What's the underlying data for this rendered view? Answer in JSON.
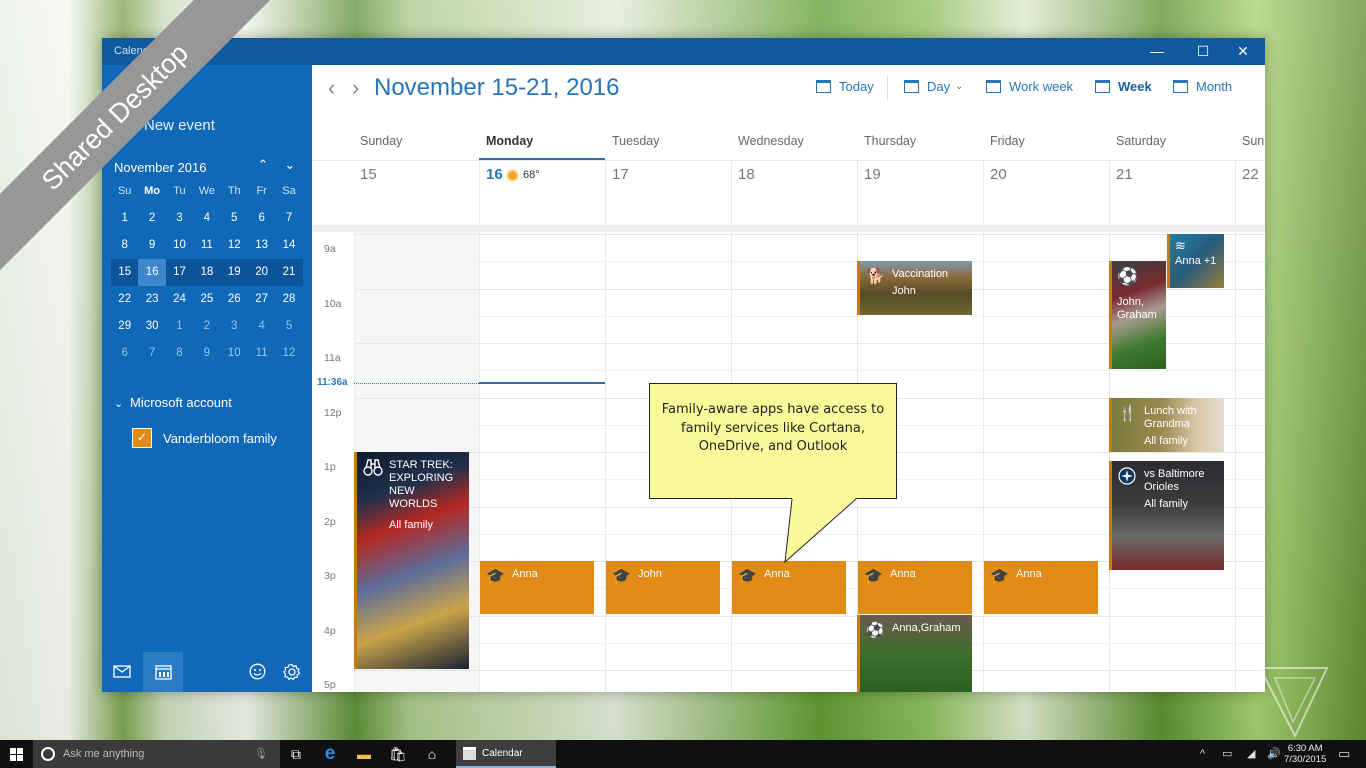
{
  "window": {
    "title": "Calendar",
    "controls": {
      "minimize": "—",
      "maximize": "☐",
      "close": "✕"
    }
  },
  "sidebar": {
    "new_event_label": "New event",
    "mini_calendar": {
      "month_label": "November 2016",
      "prev_icon": "chevron-up-icon",
      "next_icon": "chevron-down-icon",
      "weekdays": [
        "Su",
        "Mo",
        "Tu",
        "We",
        "Th",
        "Fr",
        "Sa"
      ],
      "weeks": [
        [
          "1",
          "2",
          "3",
          "4",
          "5",
          "6",
          "7"
        ],
        [
          "8",
          "9",
          "10",
          "11",
          "12",
          "13",
          "14"
        ],
        [
          "15",
          "16",
          "17",
          "18",
          "19",
          "20",
          "21"
        ],
        [
          "22",
          "23",
          "24",
          "25",
          "26",
          "27",
          "28"
        ],
        [
          "29",
          "30",
          "1",
          "2",
          "3",
          "4",
          "5"
        ],
        [
          "6",
          "7",
          "8",
          "9",
          "10",
          "11",
          "12"
        ]
      ],
      "selected_day": "16"
    },
    "account": {
      "label": "Microsoft account",
      "calendars": [
        {
          "name": "Vanderbloom family",
          "checked": true,
          "color": "#e28a16"
        }
      ]
    },
    "bottom_icons": [
      "mail-icon",
      "calendar-icon",
      "feedback-smiley-icon",
      "settings-gear-icon"
    ]
  },
  "toolbar": {
    "range_title": "November 15-21, 2016",
    "views": [
      {
        "label": "Today",
        "active": false
      },
      {
        "label": "Day",
        "active": false,
        "dropdown": true
      },
      {
        "label": "Work week",
        "active": false
      },
      {
        "label": "Week",
        "active": true
      },
      {
        "label": "Month",
        "active": false
      }
    ]
  },
  "week": {
    "days": [
      {
        "name": "Sunday",
        "date": "15"
      },
      {
        "name": "Monday",
        "date": "16",
        "today": true,
        "weather": "68°"
      },
      {
        "name": "Tuesday",
        "date": "17"
      },
      {
        "name": "Wednesday",
        "date": "18"
      },
      {
        "name": "Thursday",
        "date": "19"
      },
      {
        "name": "Friday",
        "date": "20"
      },
      {
        "name": "Saturday",
        "date": "21"
      },
      {
        "name": "Sun",
        "date": "22"
      }
    ],
    "hours": [
      "9a",
      "10a",
      "11a",
      "12p",
      "1p",
      "2p",
      "3p",
      "4p",
      "5p"
    ],
    "current_time": "11:36a"
  },
  "events": [
    {
      "title": "Vaccination",
      "sub": "John",
      "icon": "dog-icon"
    },
    {
      "title": "John, Graham",
      "sub": "",
      "icon": "soccer-ball-icon"
    },
    {
      "title": "Anna +1",
      "sub": "",
      "icon": "swimming-icon"
    },
    {
      "title": "Lunch with Grandma",
      "sub": "All family",
      "icon": "fork-knife-icon"
    },
    {
      "title": "vs Baltimore Orioles",
      "sub": "All family",
      "icon": "mariners-logo-icon"
    },
    {
      "title": "STAR TREK: EXPLORING NEW WORLDS",
      "sub": "All family",
      "icon": "binoculars-icon"
    },
    {
      "title": "Anna",
      "sub": "",
      "icon": "graduation-cap-icon"
    },
    {
      "title": "John",
      "sub": "",
      "icon": "graduation-cap-icon"
    },
    {
      "title": "Anna",
      "sub": "",
      "icon": "graduation-cap-icon"
    },
    {
      "title": "Anna",
      "sub": "",
      "icon": "graduation-cap-icon"
    },
    {
      "title": "Anna",
      "sub": "",
      "icon": "graduation-cap-icon"
    },
    {
      "title": "Anna,Graham",
      "sub": "",
      "icon": "soccer-ball-icon"
    }
  ],
  "callout": {
    "text": "Family-aware apps have access to family services like Cortana, OneDrive, and Outlook"
  },
  "banner": {
    "text": "Shared Desktop"
  },
  "taskbar": {
    "search_placeholder": "Ask me anything",
    "pinned": [
      "task-view-icon",
      "edge-icon",
      "file-explorer-icon",
      "store-icon",
      "home-icon"
    ],
    "running_app": "Calendar",
    "time": "6:30 AM",
    "date": "7/30/2015"
  },
  "colors": {
    "accent": "#1068b8",
    "title_blue": "#2775b8",
    "event_orange": "#e28a16",
    "callout_yellow": "#fafa9a"
  }
}
